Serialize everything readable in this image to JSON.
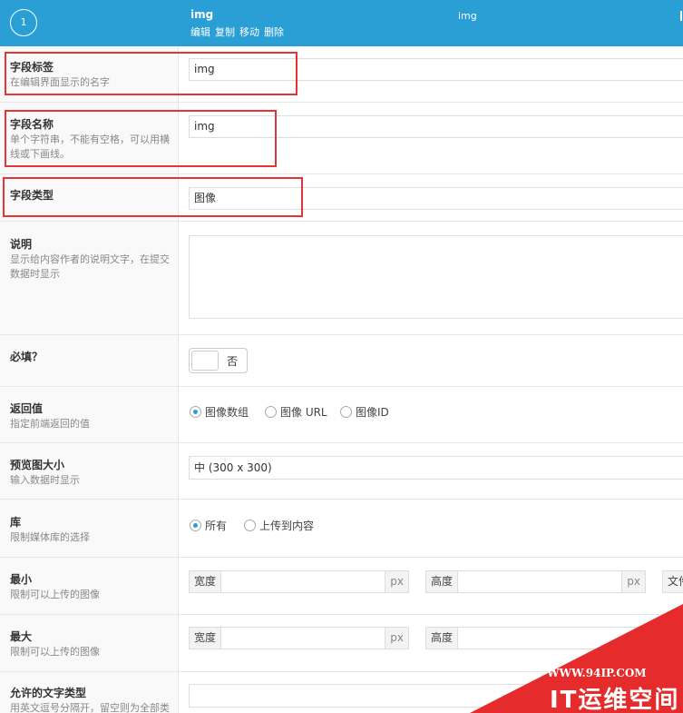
{
  "header": {
    "number": "1",
    "field_label": "img",
    "actions": [
      "编辑",
      "复制",
      "移动",
      "删除"
    ],
    "field_name": "img"
  },
  "fields": {
    "label": {
      "title": "字段标签",
      "desc": "在编辑界面显示的名字",
      "value": "img"
    },
    "name": {
      "title": "字段名称",
      "desc": "单个字符串，不能有空格，可以用横线或下画线。",
      "value": "img"
    },
    "type": {
      "title": "字段类型",
      "value": "图像"
    },
    "instructions": {
      "title": "说明",
      "desc": "显示给内容作者的说明文字，在提交数据时显示",
      "value": ""
    },
    "required": {
      "title": "必填？",
      "toggle_text": "否"
    },
    "return_value": {
      "title": "返回值",
      "desc": "指定前端返回的值",
      "options": [
        "图像数组",
        "图像 URL",
        "图像ID"
      ],
      "selected": 0
    },
    "preview_size": {
      "title": "预览图大小",
      "desc": "输入数据时显示",
      "value": "中 (300 x 300)"
    },
    "library": {
      "title": "库",
      "desc": "限制媒体库的选择",
      "options": [
        "所有",
        "上传到内容"
      ],
      "selected": 0
    },
    "min": {
      "title": "最小",
      "desc": "限制可以上传的图像",
      "width_label": "宽度",
      "height_label": "高度",
      "unit": "px",
      "file_label": "文件"
    },
    "max": {
      "title": "最大",
      "desc": "限制可以上传的图像",
      "width_label": "宽度",
      "height_label": "高度",
      "unit": "px"
    },
    "mime": {
      "title": "允许的文字类型",
      "desc": "用英文逗号分隔开，留空则为全部类"
    }
  },
  "watermark": {
    "url": "WWW.94IP.COM",
    "brand": "IT运维空间"
  },
  "colors": {
    "header": "#2a9fd6",
    "highlight": "#e33535",
    "watermark": "#e52b2b"
  }
}
